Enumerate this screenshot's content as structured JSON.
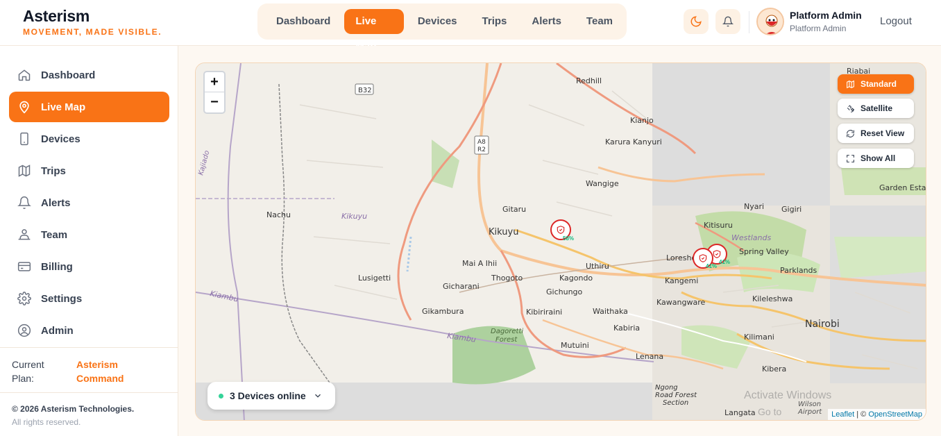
{
  "brand": {
    "name": "Asterism",
    "tagline": "MOVEMENT, MADE VISIBLE."
  },
  "topnav": {
    "tabs": [
      {
        "label": "Dashboard",
        "active": false
      },
      {
        "label": "Live Map",
        "active": true
      },
      {
        "label": "Devices",
        "active": false
      },
      {
        "label": "Trips",
        "active": false
      },
      {
        "label": "Alerts",
        "active": false
      },
      {
        "label": "Team",
        "active": false
      }
    ]
  },
  "header": {
    "theme_icon": "moon-icon",
    "notification_icon": "bell-icon"
  },
  "user": {
    "name": "Platform Admin",
    "role": "Platform Admin",
    "logout": "Logout"
  },
  "sidebar": {
    "items": [
      {
        "label": "Dashboard",
        "icon": "home-icon"
      },
      {
        "label": "Live Map",
        "icon": "map-pin-icon",
        "active": true
      },
      {
        "label": "Devices",
        "icon": "phone-icon"
      },
      {
        "label": "Trips",
        "icon": "map-icon"
      },
      {
        "label": "Alerts",
        "icon": "bell-icon"
      },
      {
        "label": "Team",
        "icon": "users-icon"
      },
      {
        "label": "Billing",
        "icon": "credit-card-icon"
      },
      {
        "label": "Settings",
        "icon": "gear-icon"
      },
      {
        "label": "Admin",
        "icon": "user-circle-icon"
      }
    ]
  },
  "plan": {
    "label": "Current Plan:",
    "value": "Asterism Command"
  },
  "footer": {
    "copyright": "© 2026 Asterism Technologies.",
    "rights": "All rights reserved."
  },
  "map": {
    "zoom_in": "+",
    "zoom_out": "−",
    "controls": [
      {
        "label": "Standard",
        "active": true,
        "icon": "map-icon"
      },
      {
        "label": "Satellite",
        "icon": "satellite-icon"
      },
      {
        "label": "Reset View",
        "icon": "refresh-icon"
      },
      {
        "label": "Show All",
        "icon": "expand-icon"
      }
    ],
    "devices_online": "3 Devices online",
    "markers": [
      {
        "percent": "58%"
      },
      {
        "percent": "41%"
      },
      {
        "percent": "41%"
      }
    ],
    "attribution": {
      "leaflet": "Leaflet",
      "sep": " | © ",
      "osm": "OpenStreetMap"
    },
    "places": [
      "Redhill",
      "Kianjo",
      "Karura Kanyuri",
      "Wangige",
      "Gitaru",
      "Kikuyu",
      "Nachu",
      "Kikuyu",
      "Mai A Ihii",
      "Lusigetti",
      "Thogoto",
      "Kagondo",
      "Gicharani",
      "Gichungo",
      "Gikambura",
      "Kibiriraini",
      "Waithaka",
      "Kabiria",
      "Dagoretti Forest",
      "Mutuini",
      "Lenana",
      "Uthiru",
      "Kitisuru",
      "Spring Valley",
      "Loresho",
      "Westlands",
      "Kangemi",
      "Parklands",
      "Kawangware",
      "Kileleshwa",
      "Nairobi",
      "Kilimani",
      "Kibera",
      "Nyari",
      "Gigiri",
      "Riabai",
      "Garden Estate",
      "Ngong Road Forest Section",
      "Langata",
      "Wilson Airport",
      "Kiambu",
      "Kiambu",
      "Kajiado",
      "B32",
      "A8 R2"
    ],
    "watermark": [
      "Activate Windows",
      "Go to"
    ]
  }
}
